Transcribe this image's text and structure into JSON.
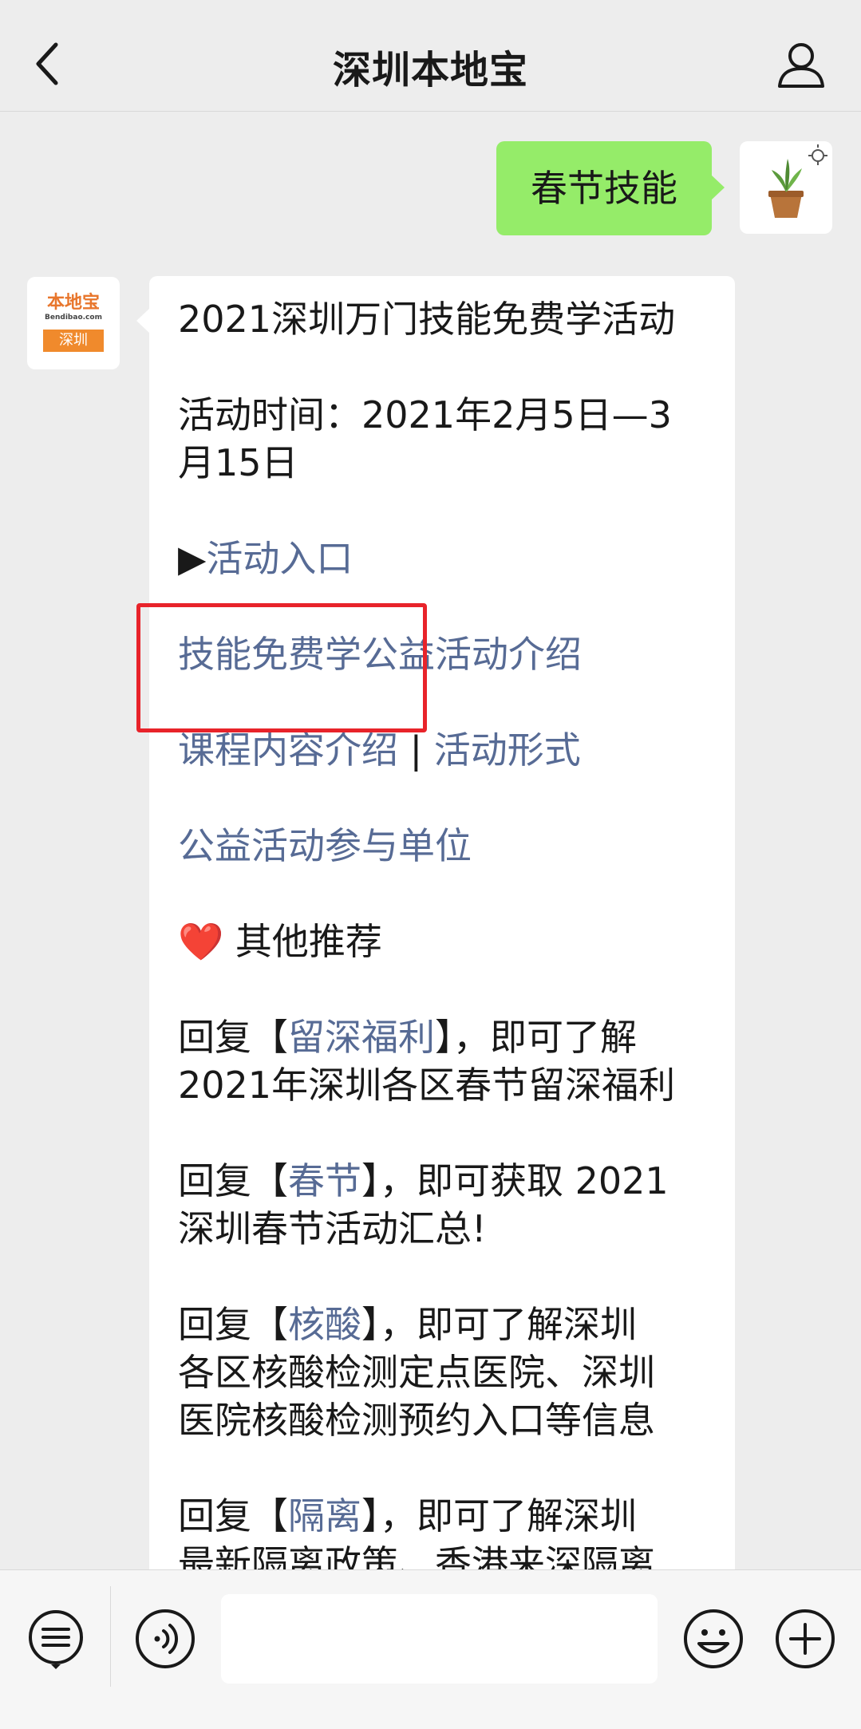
{
  "header": {
    "title": "深圳本地宝"
  },
  "chat": {
    "my_message": "春节技能",
    "bot_avatar": {
      "logo_text": "本地宝",
      "logo_url_text": "Bendibao.com",
      "city_text": "深圳"
    },
    "bot_message": {
      "line1": "2021深圳万门技能免费学活动",
      "line2": "活动时间：2021年2月5日—3",
      "line3": "月15日",
      "entry_arrow": "▶",
      "entry_link": "活动入口",
      "link_intro": "技能免费学公益活动介绍",
      "link_course": "课程内容介绍",
      "separator": " | ",
      "link_format": "活动形式",
      "link_units": "公益活动参与单位",
      "heart": "❤️",
      "other_recommend": " 其他推荐",
      "reply1_pre": "回复【",
      "reply1_kw": "留深福利",
      "reply1_post": "】，即可了解",
      "reply1_line2": "2021年深圳各区春节留深福利",
      "reply2_pre": "回复【",
      "reply2_kw": "春节",
      "reply2_post": "】，即可获取 2021",
      "reply2_line2": "深圳春节活动汇总!",
      "reply3_pre": "回复【",
      "reply3_kw": "核酸",
      "reply3_post": "】，即可了解深圳",
      "reply3_line2": "各区核酸检测定点医院、深圳",
      "reply3_line3": "医院核酸检测预约入口等信息",
      "reply4_pre": "回复【",
      "reply4_kw": "隔离",
      "reply4_post": "】，即可了解深圳",
      "reply4_line2": "最新隔离政策、香港来深隔离"
    }
  },
  "input_bar": {
    "input_value": ""
  },
  "colors": {
    "link": "#576b95",
    "my_bubble": "#95ec69",
    "highlight": "#e8232a"
  }
}
